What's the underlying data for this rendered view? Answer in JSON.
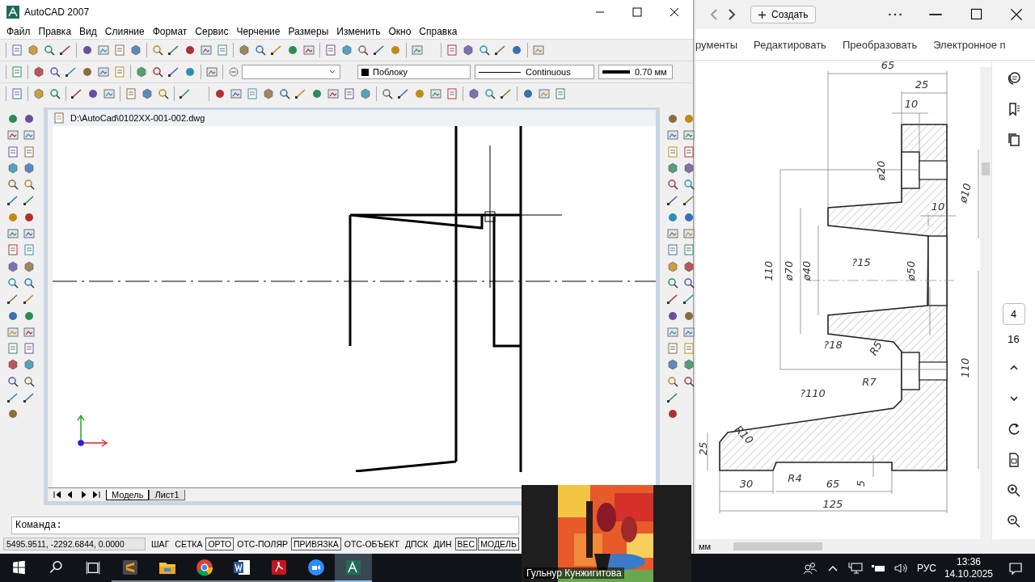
{
  "autocad": {
    "title": "AutoCAD 2007",
    "menu": [
      "Файл",
      "Правка",
      "Вид",
      "Слияние",
      "Формат",
      "Сервис",
      "Черчение",
      "Размеры",
      "Изменить",
      "Окно",
      "Справка"
    ],
    "color_combo": "Поблоку",
    "linetype_combo": "Continuous",
    "lineweight_combo": "0.70 мм",
    "document": {
      "title": "D:\\AutoCad\\0102XX-001-002.dwg",
      "tabs": [
        {
          "label": "Модель",
          "selected": true
        },
        {
          "label": "Лист1",
          "selected": false
        }
      ]
    },
    "command_line": {
      "prompt": "Команда:"
    },
    "status_bar": {
      "coordinates": "5495.9511, -2292.6844, 0.0000",
      "toggles": [
        {
          "label": "ШАГ",
          "on": false
        },
        {
          "label": "СЕТКА",
          "on": false
        },
        {
          "label": "ОРТО",
          "on": true
        },
        {
          "label": "ОТС-ПОЛЯР",
          "on": false
        },
        {
          "label": "ПРИВЯЗКА",
          "on": true
        },
        {
          "label": "ОТС-ОБЪЕКТ",
          "on": false
        },
        {
          "label": "ДПСК",
          "on": false
        },
        {
          "label": "ДИН",
          "on": false
        },
        {
          "label": "ВЕС",
          "on": true
        },
        {
          "label": "МОДЕЛЬ",
          "on": true
        }
      ]
    }
  },
  "pdf_viewer": {
    "create_button": "Создать",
    "menu": [
      "рументы",
      "Редактировать",
      "Преобразовать",
      "Электронное п"
    ],
    "dimension_labels": [
      "65",
      "25",
      "10",
      "ø20",
      "ø10",
      "10",
      "110",
      "ø70",
      "ø40",
      "?15",
      "ø50",
      "?18",
      "R5",
      "R7",
      "?110",
      "R10",
      "25",
      "R4",
      "30",
      "65",
      "5",
      "125",
      "110"
    ],
    "page": {
      "current": "4",
      "total": "16"
    },
    "units": "мм"
  },
  "video_tile": {
    "kind": "picture",
    "participant": "Гульнур Кунжигитова"
  },
  "taskbar": {
    "apps": [
      {
        "kind": "sublime",
        "selected": false
      },
      {
        "kind": "explorer",
        "selected": false
      },
      {
        "kind": "chrome",
        "selected": false
      },
      {
        "kind": "word",
        "selected": false
      },
      {
        "kind": "acrobat",
        "selected": false
      },
      {
        "kind": "zoom",
        "selected": false
      },
      {
        "kind": "autocad",
        "selected": true
      }
    ],
    "language": "РУС",
    "time": "13:36",
    "date": "14.10.2025"
  }
}
